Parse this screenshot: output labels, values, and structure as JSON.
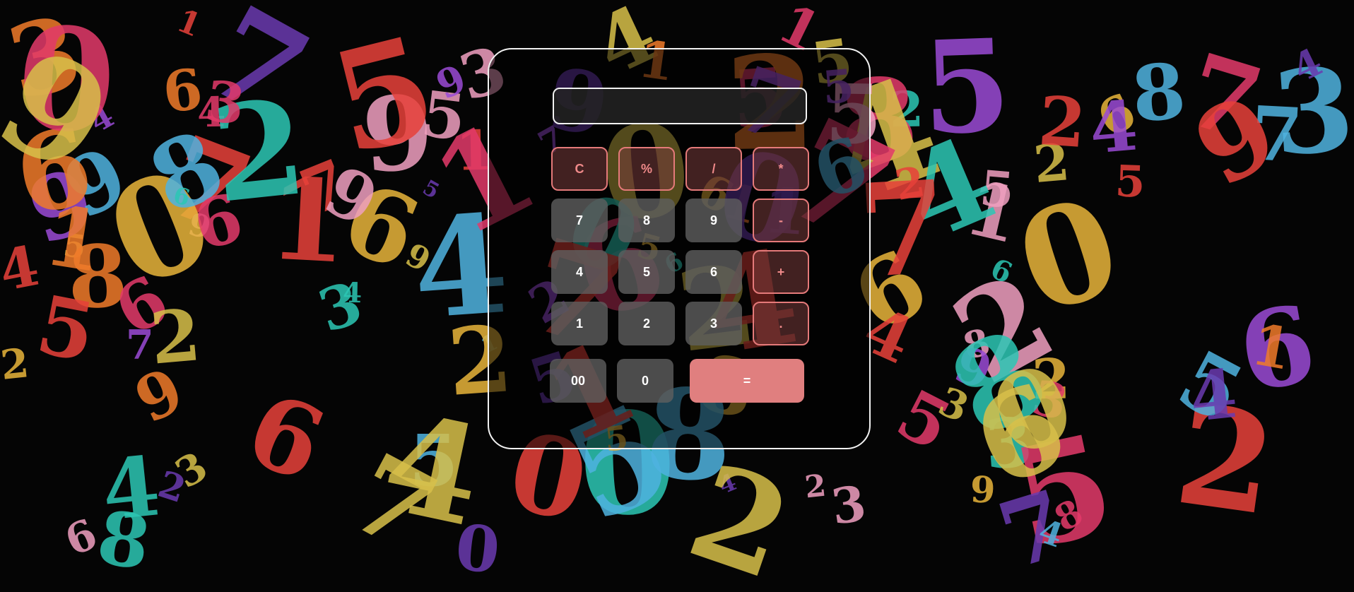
{
  "background": {
    "numbers": [
      "5",
      "4",
      "2",
      "2",
      "6",
      "7",
      "9",
      "1",
      "3",
      "0",
      "8",
      "5",
      "4",
      "6",
      "7",
      "2",
      "9",
      "5",
      "1",
      "0",
      "8",
      "3",
      "6",
      "4",
      "9",
      "7",
      "2",
      "5",
      "1",
      "6",
      "4",
      "0",
      "9",
      "5",
      "7",
      "2",
      "8",
      "3",
      "5",
      "4",
      "6",
      "1"
    ]
  },
  "calculator": {
    "display_value": "",
    "keys": {
      "clear": "C",
      "percent": "%",
      "divide": "/",
      "multiply": "*",
      "seven": "7",
      "eight": "8",
      "nine": "9",
      "minus": "-",
      "four": "4",
      "five": "5",
      "six": "6",
      "plus": "+",
      "one": "1",
      "two": "2",
      "three": "3",
      "dot": ".",
      "double_zero": "00",
      "zero": "0",
      "equals": "="
    }
  },
  "colors": {
    "operator_border": "#e57a7a",
    "operator_text": "#f08a8a",
    "number_key": "#5f5f5f",
    "equals_key": "#e07f7f",
    "frame": "#f2f2f2"
  }
}
